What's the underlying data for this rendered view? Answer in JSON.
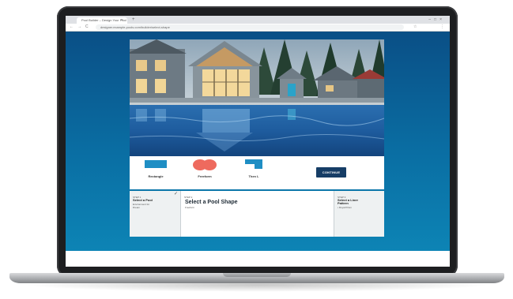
{
  "browser": {
    "tab_title": "Pool Builder – Design Your Pool",
    "tab_close": "×",
    "new_tab": "+",
    "window_controls": "–□×",
    "nav_back": "←",
    "nav_forward": "→",
    "nav_reload": "C",
    "url": "designer.example-pools.com/builder/select-shape",
    "star": "☆",
    "menu": "⋮"
  },
  "shapes": {
    "items": [
      {
        "label": "Rectangle",
        "color": "#1f8ec4"
      },
      {
        "label": "Freeform",
        "color": "#ee6a5e"
      },
      {
        "label": "Then L",
        "color": "#1f8ec4"
      }
    ],
    "continue_label": "CONTINUE"
  },
  "steps": {
    "step1": {
      "num": "STEP 1",
      "title_line1": "Select a Pool",
      "sub_line1": "Environment for",
      "sub_line2": "Dream"
    },
    "step2": {
      "num": "STEP 2",
      "title": "Select a Pool Shape",
      "sub": "Freeform"
    },
    "step3": {
      "num": "STEP 3",
      "title_line1": "Select a Liner",
      "title_line2": "Pattern",
      "sub_line1": "• Royal Prism"
    },
    "check": "✓"
  },
  "colors": {
    "page_gradient_top": "#0a4f86",
    "page_gradient_bottom": "#0d84b5",
    "continue_button": "#163d66"
  }
}
